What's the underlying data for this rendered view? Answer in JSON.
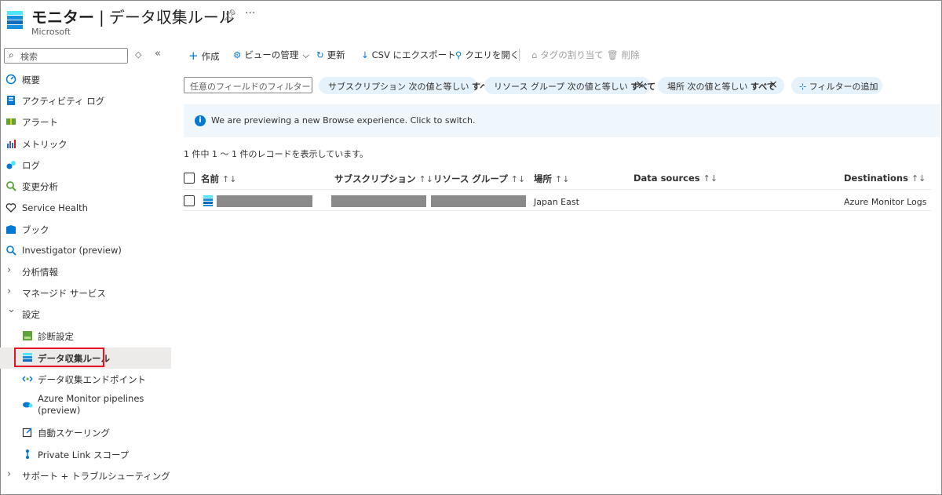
{
  "header": {
    "title_main": "モニター",
    "title_sep": "|",
    "title_page": "データ収集ルール",
    "subtitle": "Microsoft",
    "pin_icon": "pin-icon",
    "more_label": "···"
  },
  "sidebar": {
    "search_placeholder": "検索",
    "collapse_label": "«",
    "updown_label": "◇",
    "items": [
      {
        "label": "概要",
        "icon": "overview-icon"
      },
      {
        "label": "アクティビティ ログ",
        "icon": "activity-log-icon"
      },
      {
        "label": "アラート",
        "icon": "alerts-icon"
      },
      {
        "label": "メトリック",
        "icon": "metrics-icon"
      },
      {
        "label": "ログ",
        "icon": "logs-icon"
      },
      {
        "label": "変更分析",
        "icon": "change-analysis-icon"
      },
      {
        "label": "Service Health",
        "icon": "heart-icon"
      },
      {
        "label": "ブック",
        "icon": "workbook-icon"
      },
      {
        "label": "Investigator (preview)",
        "icon": "investigator-icon"
      },
      {
        "label": "分析情報",
        "icon": "chevron-right-icon"
      },
      {
        "label": "マネージド サービス",
        "icon": "chevron-right-icon"
      },
      {
        "label": "設定",
        "icon": "chevron-down-icon"
      },
      {
        "label": "診断設定",
        "icon": "diagnostic-settings-icon"
      },
      {
        "label": "データ収集ルール",
        "icon": "data-collection-rule-icon"
      },
      {
        "label": "データ収集エンドポイント",
        "icon": "endpoint-icon"
      },
      {
        "label": "Azure Monitor pipelines",
        "label2": "(preview)",
        "icon": "pipeline-icon"
      },
      {
        "label": "自動スケーリング",
        "icon": "autoscale-icon"
      },
      {
        "label": "Private Link スコープ",
        "icon": "private-link-icon"
      },
      {
        "label": "サポート + トラブルシューティング",
        "icon": "chevron-right-icon"
      }
    ]
  },
  "toolbar": {
    "create": "作成",
    "manage_view": "ビューの管理",
    "refresh": "更新",
    "export_csv": "CSV にエクスポート",
    "open_query": "クエリを開く",
    "assign_tags": "タグの割り当て",
    "delete": "削除"
  },
  "filters": {
    "placeholder": "任意のフィールドのフィルター...",
    "pills": [
      {
        "text": "サブスクリプション 次の値と等しい",
        "value": "すべて"
      },
      {
        "text": "リソース グループ 次の値と等しい",
        "value": "すべて"
      },
      {
        "text": "場所 次の値と等しい",
        "value": "すべて"
      }
    ],
    "add_filter": "フィルターの追加"
  },
  "banner": {
    "info_glyph": "i",
    "message": "We are previewing a new Browse experience. Click to switch."
  },
  "records_text": "1 件中 1 ～ 1 件のレコードを表示しています。",
  "table": {
    "columns": [
      "名前",
      "サブスクリプション",
      "リソース グループ",
      "場所",
      "Data sources",
      "Destinations"
    ],
    "sort_glyph": "↑↓",
    "rows": [
      {
        "name": "",
        "subscription": "",
        "resource_group": "",
        "location": "Japan East",
        "data_sources": "",
        "destinations": "Azure Monitor Logs"
      }
    ]
  },
  "colors": {
    "accent": "#0078d4",
    "pill_bg": "#e5f1fb",
    "banner_bg": "#eff6fc",
    "selected_bg": "#edebe9",
    "highlight_border": "#e81123",
    "redacted": "#8a8a8a"
  }
}
